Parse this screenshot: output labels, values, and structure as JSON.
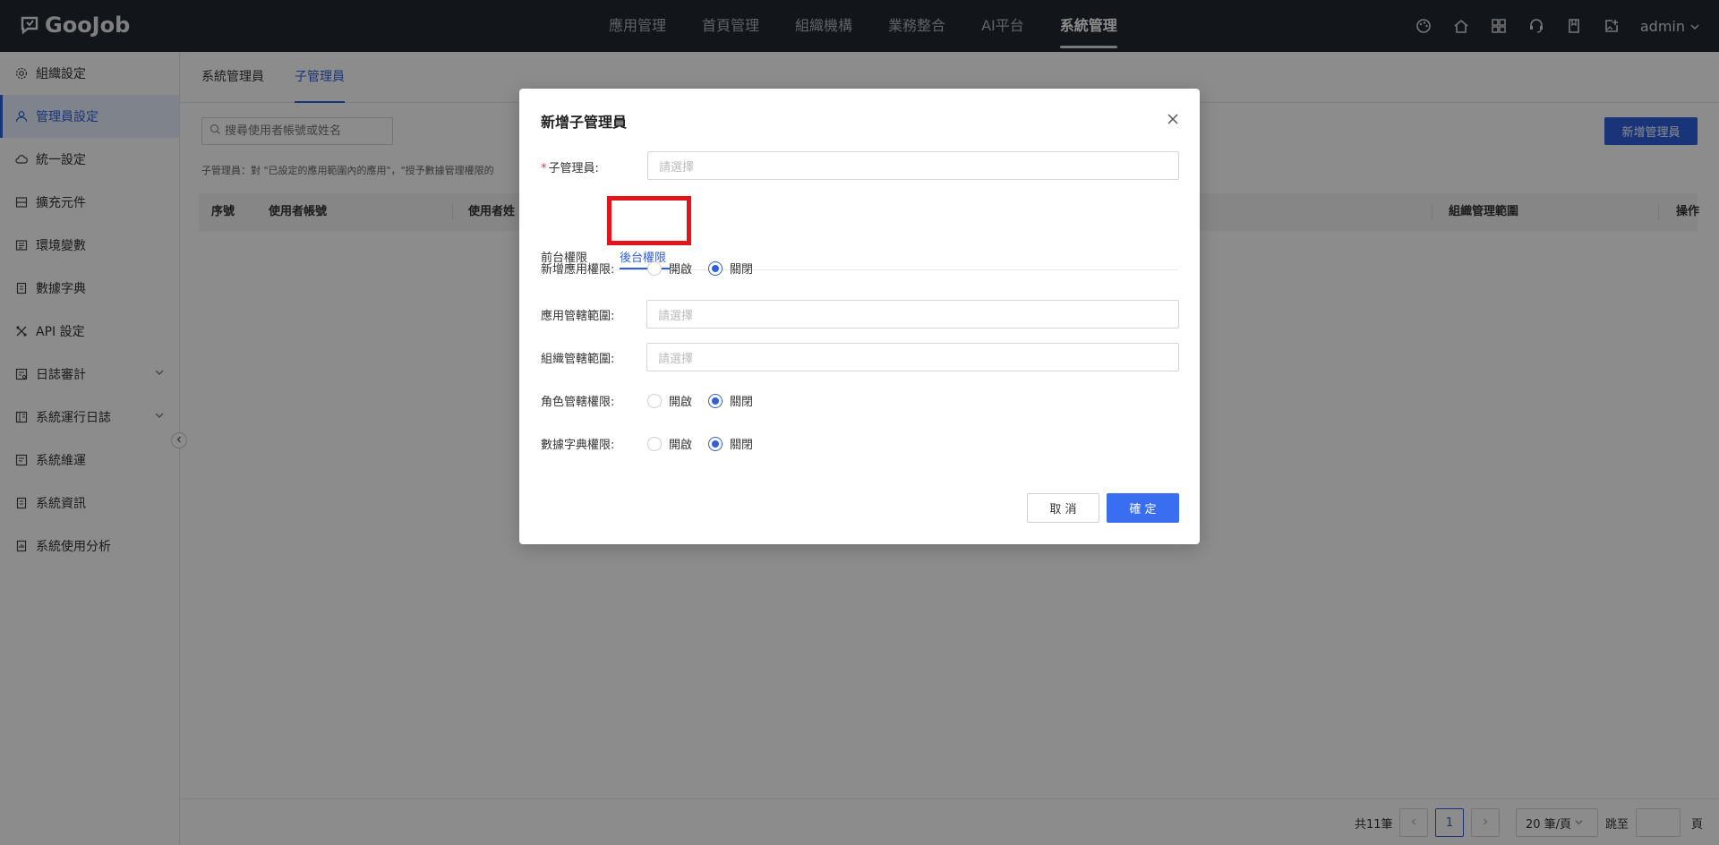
{
  "app": {
    "logo_text": "GooJob"
  },
  "topnav": [
    {
      "label": "應用管理"
    },
    {
      "label": "首頁管理"
    },
    {
      "label": "組織機構"
    },
    {
      "label": "業務整合"
    },
    {
      "label": "AI平台"
    },
    {
      "label": "系統管理",
      "active": true
    }
  ],
  "user": {
    "name": "admin"
  },
  "sidebar": {
    "items": [
      {
        "label": "組織設定",
        "icon": "gear-icon"
      },
      {
        "label": "管理員設定",
        "icon": "user-icon",
        "active": true
      },
      {
        "label": "統一設定",
        "icon": "cloud-icon"
      },
      {
        "label": "擴充元件",
        "icon": "box-icon"
      },
      {
        "label": "環境變數",
        "icon": "list-icon"
      },
      {
        "label": "數據字典",
        "icon": "book-icon"
      },
      {
        "label": "API 設定",
        "icon": "tools-icon"
      },
      {
        "label": "日誌審計",
        "icon": "audit-icon",
        "expandable": true
      },
      {
        "label": "系統運行日誌",
        "icon": "log-icon",
        "expandable": true
      },
      {
        "label": "系統維運",
        "icon": "maintain-icon"
      },
      {
        "label": "系統資訊",
        "icon": "info-icon"
      },
      {
        "label": "系統使用分析",
        "icon": "analysis-icon"
      }
    ]
  },
  "main": {
    "tabs": [
      {
        "label": "系統管理員"
      },
      {
        "label": "子管理員",
        "active": true
      }
    ],
    "search_placeholder": "搜尋使用者帳號或姓名",
    "new_admin_button": "新增管理員",
    "hint": "子管理員：對 \"已設定的應用範圍內的應用\"，\"授予數據管理權限的",
    "table_headers": [
      "序號",
      "使用者帳號",
      "使用者姓",
      "組織管理範圍",
      "操作"
    ]
  },
  "pager": {
    "total": "共11筆",
    "current_page": "1",
    "page_size": "20 筆/頁",
    "jump_label": "跳至",
    "page_label": "頁"
  },
  "modal": {
    "title": "新增子管理員",
    "sub_admin_label": "子管理員:",
    "sub_admin_placeholder": "請選擇",
    "tabs": [
      {
        "label": "前台權限"
      },
      {
        "label": "後台權限",
        "active": true
      }
    ],
    "fields": {
      "add_app_perm": {
        "label": "新增應用權限:",
        "on": "開啟",
        "off": "關閉",
        "value": "off"
      },
      "app_scope": {
        "label": "應用管轄範圍:",
        "placeholder": "請選擇"
      },
      "org_scope": {
        "label": "組織管轄範圍:",
        "placeholder": "請選擇"
      },
      "role_perm": {
        "label": "角色管轄權限:",
        "on": "開啟",
        "off": "關閉",
        "value": "off"
      },
      "dict_perm": {
        "label": "數據字典權限:",
        "on": "開啟",
        "off": "關閉",
        "value": "off"
      }
    },
    "cancel_label": "取 消",
    "ok_label": "確 定"
  },
  "colors": {
    "accent": "#2f5fdc",
    "topbar": "#222731",
    "highlight": "#e3151a"
  }
}
